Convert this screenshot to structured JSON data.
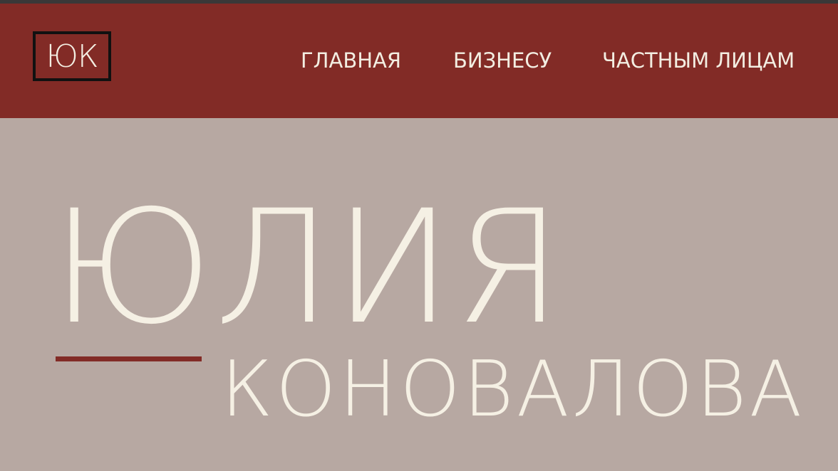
{
  "header": {
    "logo_text": "ЮК",
    "nav": [
      "ГЛАВНАЯ",
      "БИЗНЕСУ",
      "ЧАСТНЫМ ЛИЦАМ"
    ]
  },
  "hero": {
    "first_name": "ЮЛИЯ",
    "last_name": "КОНОВАЛОВА"
  },
  "colors": {
    "header_bg": "#822b26",
    "page_bg": "#b7a8a2",
    "text_light": "#f5f0e4",
    "logo_border": "#111111",
    "accent_line": "#822b26"
  }
}
